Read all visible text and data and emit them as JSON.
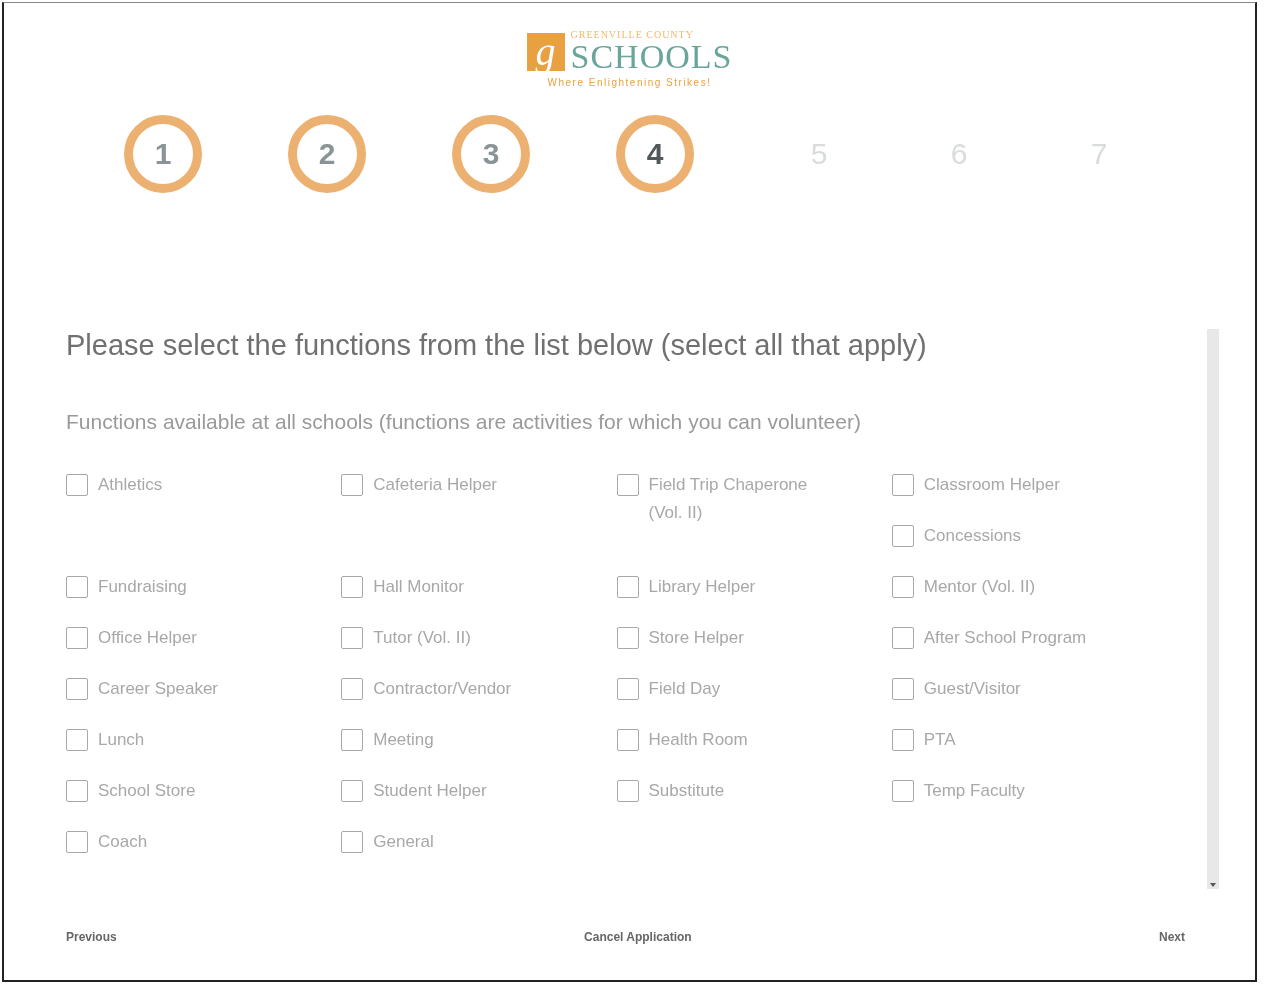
{
  "logo": {
    "mark": "g",
    "district": "GREENVILLE COUNTY",
    "name": "SCHOOLS",
    "tagline": "Where Enlightening Strikes!"
  },
  "steps": [
    {
      "number": "1",
      "kind": "done"
    },
    {
      "number": "2",
      "kind": "done"
    },
    {
      "number": "3",
      "kind": "done"
    },
    {
      "number": "4",
      "kind": "current"
    },
    {
      "number": "5",
      "kind": "upcoming"
    },
    {
      "number": "6",
      "kind": "upcoming"
    },
    {
      "number": "7",
      "kind": "upcoming"
    }
  ],
  "heading": "Please select the functions from the list below (select all that apply)",
  "subheading": "Functions available at all schools (functions are activities for which you can volunteer)",
  "functions": [
    {
      "label": "Athletics",
      "checked": false
    },
    {
      "label": "Cafeteria Helper",
      "checked": false
    },
    {
      "label": "Field Trip Chaperone (Vol. II)",
      "checked": false
    },
    {
      "label": "Classroom Helper",
      "checked": false
    },
    {
      "label": "Concessions",
      "checked": false
    },
    {
      "label": "Fundraising",
      "checked": false
    },
    {
      "label": "Hall Monitor",
      "checked": false
    },
    {
      "label": "Library Helper",
      "checked": false
    },
    {
      "label": "Mentor (Vol. II)",
      "checked": false
    },
    {
      "label": "Office Helper",
      "checked": false
    },
    {
      "label": "Tutor (Vol. II)",
      "checked": false
    },
    {
      "label": "Store Helper",
      "checked": false
    },
    {
      "label": "After School Program",
      "checked": false
    },
    {
      "label": "Career Speaker",
      "checked": false
    },
    {
      "label": "Contractor/Vendor",
      "checked": false
    },
    {
      "label": "Field Day",
      "checked": false
    },
    {
      "label": "Guest/Visitor",
      "checked": false
    },
    {
      "label": "Lunch",
      "checked": false
    },
    {
      "label": "Meeting",
      "checked": false
    },
    {
      "label": "Health Room",
      "checked": false
    },
    {
      "label": "PTA",
      "checked": false
    },
    {
      "label": "School Store",
      "checked": false
    },
    {
      "label": "Student Helper",
      "checked": false
    },
    {
      "label": "Substitute",
      "checked": false
    },
    {
      "label": "Temp Faculty",
      "checked": false
    },
    {
      "label": "Coach",
      "checked": false
    },
    {
      "label": "General",
      "checked": false
    }
  ],
  "footer": {
    "previous": "Previous",
    "cancel": "Cancel Application",
    "next": "Next"
  }
}
